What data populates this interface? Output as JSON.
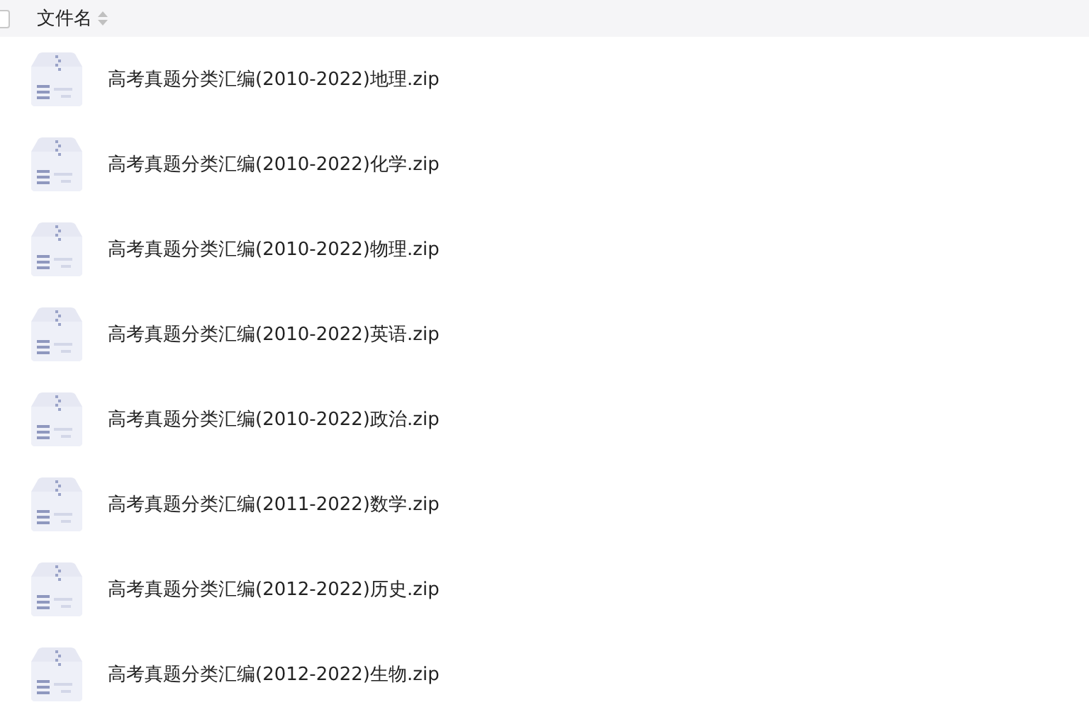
{
  "header": {
    "checkbox": {
      "checked": false
    },
    "column": "文件名"
  },
  "files": [
    {
      "name": "高考真题分类汇编(2010-2022)地理.zip"
    },
    {
      "name": "高考真题分类汇编(2010-2022)化学.zip"
    },
    {
      "name": "高考真题分类汇编(2010-2022)物理.zip"
    },
    {
      "name": "高考真题分类汇编(2010-2022)英语.zip"
    },
    {
      "name": "高考真题分类汇编(2010-2022)政治.zip"
    },
    {
      "name": "高考真题分类汇编(2011-2022)数学.zip"
    },
    {
      "name": "高考真题分类汇编(2012-2022)历史.zip"
    },
    {
      "name": "高考真题分类汇编(2012-2022)生物.zip"
    }
  ]
}
